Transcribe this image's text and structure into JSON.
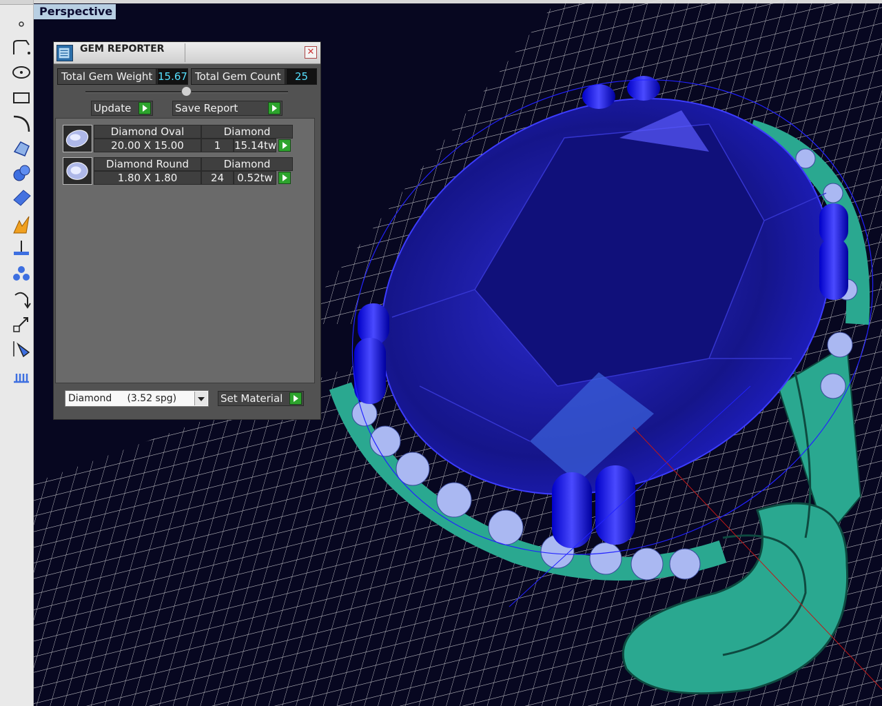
{
  "viewport": {
    "label": "Perspective"
  },
  "toolbar": {
    "tools": [
      {
        "icon": "point-icon"
      },
      {
        "icon": "curve-icon"
      },
      {
        "icon": "circle-icon"
      },
      {
        "icon": "ellipse-icon"
      },
      {
        "icon": "rectangle-icon"
      },
      {
        "icon": "arc-icon"
      },
      {
        "icon": "surface-icon"
      },
      {
        "icon": "solid-spheres-icon"
      },
      {
        "icon": "planar-surface-icon"
      },
      {
        "icon": "boolean-icon"
      },
      {
        "icon": "dimension-icon"
      },
      {
        "icon": "gem-cluster-icon"
      },
      {
        "icon": "rotate-icon"
      },
      {
        "icon": "scale-icon"
      },
      {
        "icon": "mirror-icon"
      },
      {
        "icon": "array-icon"
      }
    ]
  },
  "gem_reporter": {
    "title": "GEM REPORTER",
    "total_weight_label": "Total Gem Weight",
    "total_weight_value": "15.67",
    "total_count_label": "Total Gem Count",
    "total_count_value": "25",
    "update_label": "Update",
    "save_report_label": "Save Report",
    "gems": [
      {
        "name": "Diamond Oval",
        "material": "Diamond",
        "size": "20.00 X 15.00",
        "count": "1",
        "weight": "15.14tw"
      },
      {
        "name": "Diamond Round",
        "material": "Diamond",
        "size": "1.80 X 1.80",
        "count": "24",
        "weight": "0.52tw"
      }
    ],
    "material_select": "Diamond     (3.52 spg)",
    "set_material_label": "Set Material"
  },
  "colors": {
    "viewport_bg": "#070720",
    "grid": "#e6e6e6",
    "gem_blue": "#1c1ca8",
    "prong_blue": "#2020ff",
    "shank_green": "#2aa890",
    "value_cyan": "#56e1ff",
    "play_green": "#2da42d"
  }
}
